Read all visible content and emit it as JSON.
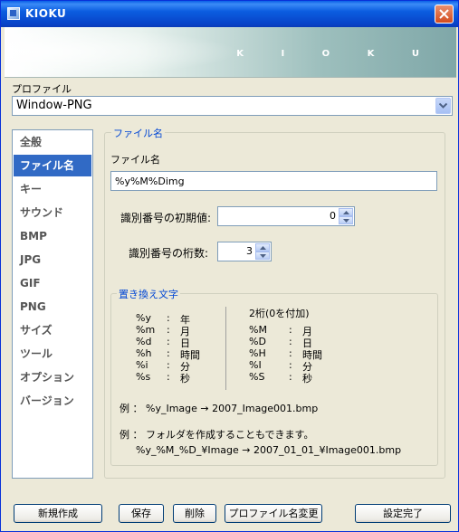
{
  "window": {
    "title": "KIOKU",
    "banner_logo": "K I O K U"
  },
  "profile": {
    "label": "プロファイル",
    "selected": "Window-PNG"
  },
  "sidebar": {
    "items": [
      {
        "label": "全般"
      },
      {
        "label": "ファイル名",
        "selected": true
      },
      {
        "label": "キー"
      },
      {
        "label": "サウンド"
      },
      {
        "label": "BMP"
      },
      {
        "label": "JPG"
      },
      {
        "label": "GIF"
      },
      {
        "label": "PNG"
      },
      {
        "label": "サイズ"
      },
      {
        "label": "ツール"
      },
      {
        "label": "オプション"
      },
      {
        "label": "バージョン"
      }
    ]
  },
  "filename_section": {
    "legend": "ファイル名",
    "field_label": "ファイル名",
    "field_value": "%y%M%Dimg",
    "id_initial_label": "識別番号の初期値:",
    "id_initial_value": "0",
    "id_digits_label": "識別番号の桁数:",
    "id_digits_value": "3"
  },
  "replace": {
    "legend": "置き換え文字",
    "left": [
      {
        "code": "%y",
        "sep": ":",
        "desc": "年"
      },
      {
        "code": "%m",
        "sep": ":",
        "desc": "月"
      },
      {
        "code": "%d",
        "sep": ":",
        "desc": "日"
      },
      {
        "code": "%h",
        "sep": ":",
        "desc": "時間"
      },
      {
        "code": "%i",
        "sep": ":",
        "desc": "分"
      },
      {
        "code": "%s",
        "sep": ":",
        "desc": "秒"
      }
    ],
    "right_heading": "2桁(0を付加)",
    "right": [
      {
        "code": "%M",
        "sep": ":",
        "desc": "月"
      },
      {
        "code": "%D",
        "sep": ":",
        "desc": "日"
      },
      {
        "code": "%H",
        "sep": ":",
        "desc": "時間"
      },
      {
        "code": "%I",
        "sep": ":",
        "desc": "分"
      },
      {
        "code": "%S",
        "sep": ":",
        "desc": "秒"
      }
    ],
    "example1": "例 ： %y_Image → 2007_Image001.bmp",
    "example2": "例 ： フォルダを作成することもできます。",
    "example3": "%y_%M_%D_¥Image → 2007_01_01_¥Image001.bmp"
  },
  "buttons": {
    "new": "新規作成",
    "save": "保存",
    "delete": "削除",
    "rename": "プロファイル名変更",
    "done": "設定完了"
  }
}
